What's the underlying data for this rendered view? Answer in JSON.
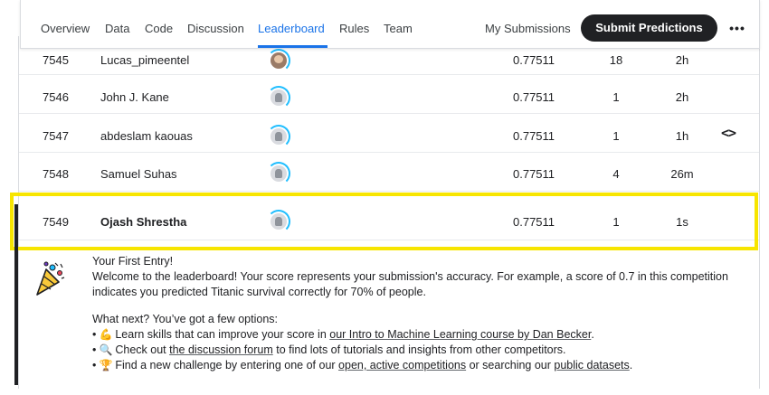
{
  "nav": {
    "tabs": [
      {
        "label": "Overview"
      },
      {
        "label": "Data"
      },
      {
        "label": "Code"
      },
      {
        "label": "Discussion"
      },
      {
        "label": "Leaderboard"
      },
      {
        "label": "Rules"
      },
      {
        "label": "Team"
      }
    ],
    "active_tab": "Leaderboard",
    "my_submissions": "My Submissions",
    "submit_button": "Submit Predictions",
    "more": "•••"
  },
  "rows": [
    {
      "rank": "7545",
      "name": "Lucas_pimeentel",
      "score": "0.77511",
      "entries": "18",
      "last": "2h",
      "avatar": "user-photo"
    },
    {
      "rank": "7546",
      "name": "John J. Kane",
      "score": "0.77511",
      "entries": "1",
      "last": "2h",
      "avatar": "default"
    },
    {
      "rank": "7547",
      "name": "abdeslam kaouas",
      "score": "0.77511",
      "entries": "1",
      "last": "1h",
      "avatar": "default"
    },
    {
      "rank": "7548",
      "name": "Samuel Suhas",
      "score": "0.77511",
      "entries": "4",
      "last": "26m",
      "avatar": "default"
    },
    {
      "rank": "7549",
      "name": "Ojash Shrestha",
      "score": "0.77511",
      "entries": "1",
      "last": "1s",
      "avatar": "default"
    }
  ],
  "code_toggle": "<>",
  "first_entry": {
    "title": "Your First Entry!",
    "line1": "Welcome to the leaderboard! Your score represents your submission's accuracy. For example, a score of 0.7 in this competition",
    "line2": "indicates you predicted Titanic survival correctly for 70% of people.",
    "next": "What next? You’ve got a few options:",
    "b1_pre": "Learn skills that can improve your score in ",
    "b1_link": "our Intro to Machine Learning course by Dan Becker",
    "b1_post": ".",
    "b2_pre": "Check out ",
    "b2_link": "the discussion forum",
    "b2_post": " to find lots of tutorials and insights from other competitors.",
    "b3_pre": "Find a new challenge by entering one of our ",
    "b3_link1": "open, active competitions",
    "b3_mid": " or searching our ",
    "b3_link2": "public datasets",
    "b3_post": ".",
    "icons": [
      "flexed-biceps-icon",
      "magnifier-icon",
      "trophy-icon",
      "party-popper-icon"
    ]
  },
  "colors": {
    "accent": "#1a73e8",
    "highlight": "#f7e500",
    "button": "#202124",
    "ring": "#20beff"
  }
}
